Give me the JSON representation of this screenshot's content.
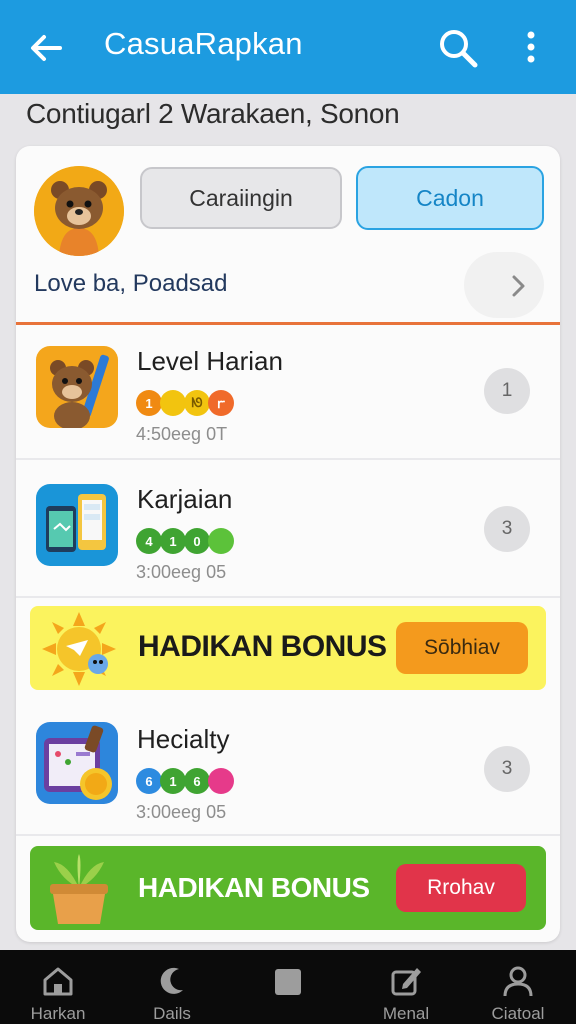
{
  "appbar": {
    "title": "CasuaRapkan",
    "bg_color": "#1d9be0",
    "icons": [
      "back-arrow-icon",
      "search-icon",
      "more-vert-icon"
    ]
  },
  "subtitle": "Contiugarl  2  Warakaen, Sonon",
  "profile": {
    "button_1": "Caraiingin",
    "button_2": "Cadon",
    "name": "Love ba, Poadsad",
    "divider_color": "#e8733a"
  },
  "items": [
    {
      "title": "Level Harian",
      "chips": [
        {
          "label": "1",
          "color": "#f08a12"
        },
        {
          "label": "",
          "color": "#f2c40f"
        },
        {
          "label": "ᘚ",
          "color": "#f2c40f"
        },
        {
          "label": "ꭈ",
          "color": "#f06a2a"
        }
      ],
      "meta": "4:50eeg 0T",
      "badge": "1",
      "icon": "bear-pencil-icon"
    },
    {
      "title": "Karjaian",
      "chips": [
        {
          "label": "4",
          "color": "#3fa432"
        },
        {
          "label": "1",
          "color": "#3fa432"
        },
        {
          "label": "0",
          "color": "#3fa432"
        },
        {
          "label": "",
          "color": "#5cc23a"
        }
      ],
      "meta": "3:00eeg 05",
      "badge": "3",
      "icon": "phone-devices-icon"
    },
    {
      "title": "Hecialty",
      "chips": [
        {
          "label": "6",
          "color": "#2d8be0"
        },
        {
          "label": "1",
          "color": "#3fa432"
        },
        {
          "label": "6",
          "color": "#3fa432"
        },
        {
          "label": "",
          "color": "#e63a8a"
        }
      ],
      "meta": "3:00eeg 05",
      "badge": "3",
      "icon": "tablet-coin-icon"
    }
  ],
  "bonus_1": {
    "text": "HADIKAN BONUS",
    "button": "Sōbhiav",
    "bg": "#fbf35e",
    "btn_color": "#f49a1d",
    "icon": "sun-character-icon"
  },
  "bonus_2": {
    "text": "HADIKAN BONUS",
    "button": "Rrohav",
    "bg": "#5ab62a",
    "btn_color": "#e1344a",
    "icon": "plant-pot-icon"
  },
  "bottom_nav": [
    {
      "label": "Harkan",
      "icon": "home-icon"
    },
    {
      "label": "Dails",
      "icon": "moon-icon"
    },
    {
      "label": "",
      "icon": "square-icon"
    },
    {
      "label": "Menal",
      "icon": "edit-box-icon"
    },
    {
      "label": "Ciatoal",
      "icon": "person-icon"
    }
  ]
}
